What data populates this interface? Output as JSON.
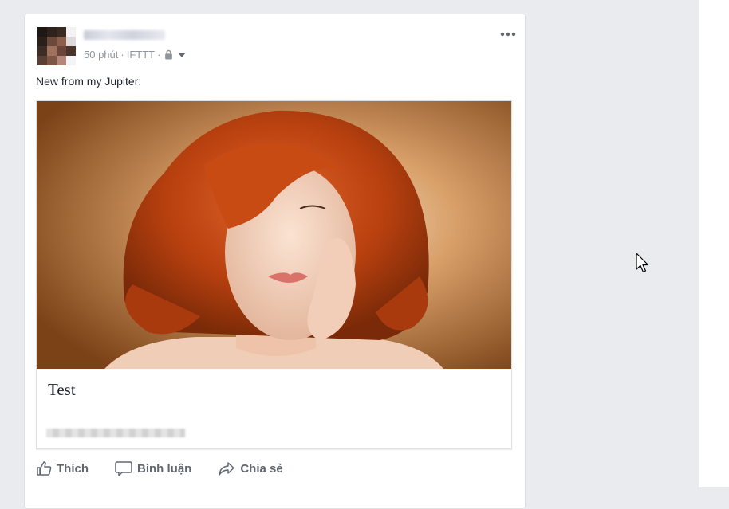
{
  "post": {
    "author_name": "",
    "time": "50 phút",
    "separator": "·",
    "via": "IFTTT",
    "audience_icon": "lock-icon",
    "text": "New from my Jupiter:",
    "link": {
      "title": "Test",
      "domain": ""
    }
  },
  "actions": {
    "like": "Thích",
    "comment": "Bình luận",
    "share": "Chia sẻ"
  },
  "colors": {
    "background": "#e9ebee",
    "card": "#ffffff",
    "meta_text": "#90949c",
    "action_text": "#606770"
  }
}
